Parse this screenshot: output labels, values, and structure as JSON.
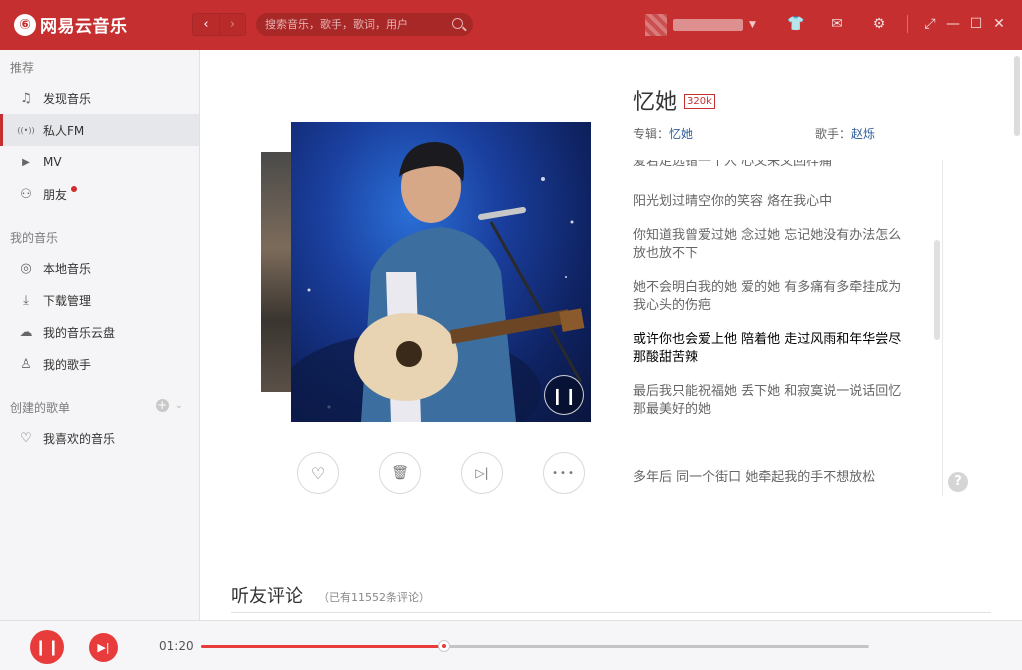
{
  "app": {
    "logo_glyph": "⑥",
    "name": "网易云音乐",
    "brand_color": "#c62f2f"
  },
  "topbar": {
    "back_glyph": "‹",
    "forward_glyph": "›",
    "search_placeholder": "搜索音乐，歌手，歌词，用户",
    "user_caret": "▼",
    "skin_glyph": "👕",
    "mail_glyph": "✉",
    "settings_glyph": "⚙",
    "mini_glyph": "⤢",
    "minimize_glyph": "—",
    "maximize_glyph": "☐",
    "close_glyph": "✕"
  },
  "sidebar": {
    "section_recommend": "推荐",
    "recommend_items": [
      {
        "label": "发现音乐",
        "icon": "♫"
      },
      {
        "label": "私人FM",
        "icon": "((•))"
      },
      {
        "label": "MV",
        "icon": "▶"
      },
      {
        "label": "朋友",
        "icon": "⚇"
      }
    ],
    "section_my_music": "我的音乐",
    "my_music_items": [
      {
        "label": "本地音乐",
        "icon": "◎"
      },
      {
        "label": "下载管理",
        "icon": "⤓"
      },
      {
        "label": "我的音乐云盘",
        "icon": "☁"
      },
      {
        "label": "我的歌手",
        "icon": "♙"
      }
    ],
    "section_created": "创建的歌单",
    "created_add": "+",
    "created_toggle": "⌄",
    "created_items": [
      {
        "label": "我喜欢的音乐",
        "icon": "♡"
      }
    ]
  },
  "song": {
    "title": "忆她",
    "quality": "320k",
    "album_label": "专辑：",
    "album": "忆她",
    "artist_label": "歌手：",
    "artist": "赵烁",
    "cover_pause_glyph": "❙❙"
  },
  "controls": {
    "like_glyph": "♡",
    "trash_glyph": "🗑",
    "next_glyph": "▷|",
    "more_glyph": "•••"
  },
  "lyrics": [
    {
      "text": "爱若走远错一个人 心又来又回梓痛",
      "current": false
    },
    {
      "text": "阳光划过晴空你的笑容 烙在我心中",
      "current": false
    },
    {
      "text": "你知道我曾爱过她 念过她 忘记她没有办法怎么放也放不下",
      "current": false
    },
    {
      "text": "她不会明白我的她 爱的她 有多痛有多牵挂成为我心头的伤疤",
      "current": false
    },
    {
      "text": "或许你也会爱上他 陪着他 走过风雨和年华尝尽那酸甜苦辣",
      "current": true
    },
    {
      "text": "最后我只能祝福她 丢下她 和寂寞说一说话回忆那最美好的她",
      "current": false
    },
    {
      "text": "多年后 同一个街口 她牵起我的手不想放松",
      "current": false
    }
  ],
  "help_glyph": "?",
  "comments": {
    "title": "听友评论",
    "count_text": "（已有11552条评论）"
  },
  "player": {
    "pause_glyph": "❙❙",
    "next_glyph": "▶|",
    "current_time": "01:20",
    "progress": 0.364
  }
}
